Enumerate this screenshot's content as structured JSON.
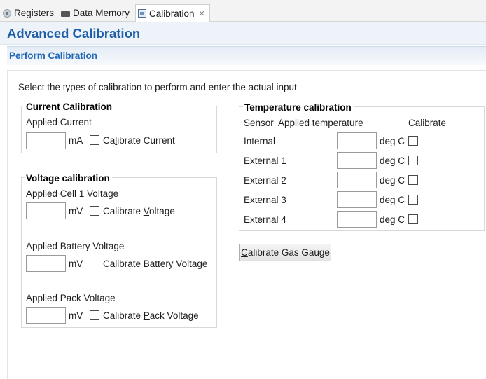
{
  "tabs": [
    {
      "label": "Registers",
      "icon": "register-icon"
    },
    {
      "label": "Data Memory",
      "icon": "memory-icon"
    },
    {
      "label": "Calibration",
      "icon": "calibration-icon",
      "close": "✕"
    }
  ],
  "page_title": "Advanced Calibration",
  "section_title": "Perform Calibration",
  "instructions": "Select the types of calibration to perform and enter the actual input",
  "current": {
    "title": "Current Calibration",
    "applied_label": "Applied Current",
    "value": "",
    "unit": "mA",
    "checkbox_pre": "Ca",
    "checkbox_ul": "l",
    "checkbox_post": "ibrate Current",
    "checked": false
  },
  "voltage": {
    "title": "Voltage calibration",
    "cell1": {
      "applied_label": "Applied Cell 1 Voltage",
      "value": "",
      "unit": "mV",
      "checkbox_pre": "Calibrate ",
      "checkbox_ul": "V",
      "checkbox_post": "oltage",
      "checked": false
    },
    "battery": {
      "applied_label": "Applied Battery Voltage",
      "value": "",
      "unit": "mV",
      "checkbox_pre": "Calibrate ",
      "checkbox_ul": "B",
      "checkbox_post": "attery Voltage",
      "checked": false
    },
    "pack": {
      "applied_label": "Applied Pack Voltage",
      "value": "",
      "unit": "mV",
      "checkbox_pre": "Calibrate ",
      "checkbox_ul": "P",
      "checkbox_post": "ack Voltage",
      "checked": false
    }
  },
  "temperature": {
    "title": "Temperature calibration",
    "col_sensor": "Sensor",
    "col_applied": "Applied temperature",
    "col_calibrate": "Calibrate",
    "unit": "deg C",
    "rows": [
      {
        "sensor": "Internal",
        "value": "",
        "checked": false
      },
      {
        "sensor": "External 1",
        "value": "",
        "checked": false
      },
      {
        "sensor": "External 2",
        "value": "",
        "checked": false
      },
      {
        "sensor": "External 3",
        "value": "",
        "checked": false
      },
      {
        "sensor": "External 4",
        "value": "",
        "checked": false
      }
    ]
  },
  "calibrate_button": {
    "ul": "C",
    "rest": "alibrate Gas Gauge"
  }
}
